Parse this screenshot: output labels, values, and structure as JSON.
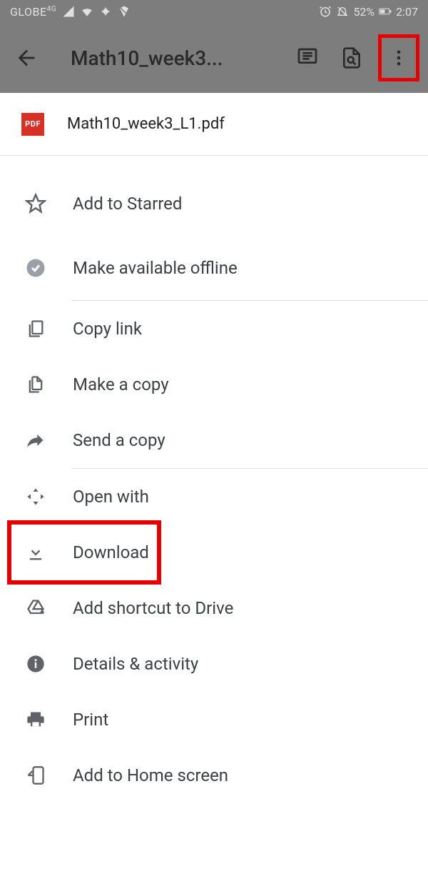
{
  "status": {
    "carrier": "GLOBE",
    "net": "4G",
    "battery": "52%",
    "time": "2:07"
  },
  "appbar": {
    "title": "Math10_week3..."
  },
  "file": {
    "badge": "PDF",
    "name": "Math10_week3_L1.pdf"
  },
  "menu": {
    "starred": "Add to Starred",
    "offline": "Make available offline",
    "copylink": "Copy link",
    "makecopy": "Make a copy",
    "sendcopy": "Send a copy",
    "openwith": "Open with",
    "download": "Download",
    "shortcut": "Add shortcut to Drive",
    "details": "Details & activity",
    "print": "Print",
    "homescreen": "Add to Home screen"
  }
}
